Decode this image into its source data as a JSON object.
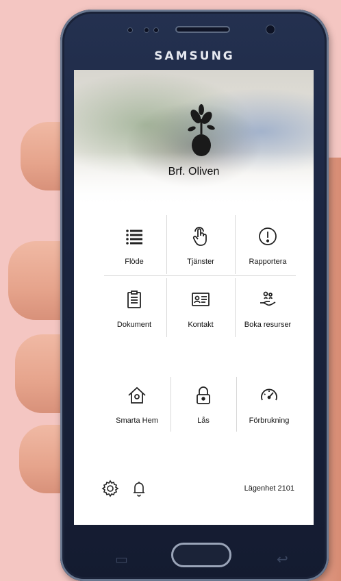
{
  "device": {
    "brand": "SAMSUNG"
  },
  "app": {
    "org_name": "Brf. Oliven",
    "apartment": "Lägenhet 2101"
  },
  "tiles": [
    {
      "label": "Flöde",
      "icon": "list-icon"
    },
    {
      "label": "Tjänster",
      "icon": "touch-icon"
    },
    {
      "label": "Rapportera",
      "icon": "alert-icon"
    },
    {
      "label": "Dokument",
      "icon": "clipboard-icon"
    },
    {
      "label": "Kontakt",
      "icon": "contact-card-icon"
    },
    {
      "label": "Boka resurser",
      "icon": "hand-people-icon"
    },
    {
      "label": "Smarta Hem",
      "icon": "home-icon"
    },
    {
      "label": "Lås",
      "icon": "lock-icon"
    },
    {
      "label": "Förbrukning",
      "icon": "gauge-icon"
    }
  ],
  "footer": {
    "settings_icon": "gear-icon",
    "notifications_icon": "bell-icon"
  }
}
